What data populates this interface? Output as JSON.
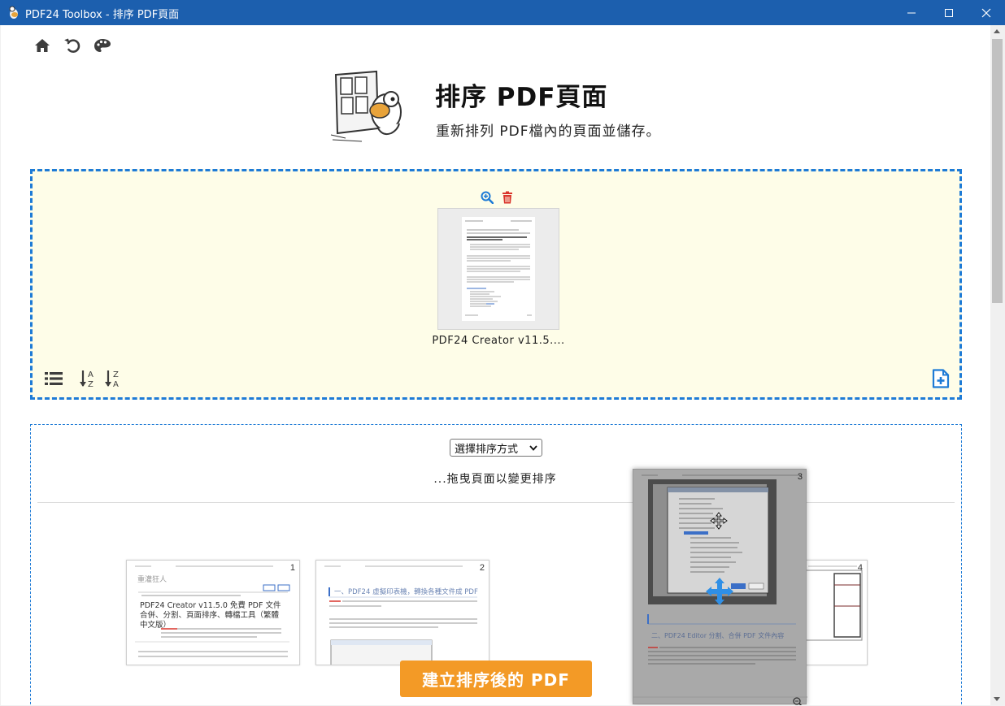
{
  "window": {
    "title": "PDF24 Toolbox - 排序 PDF頁面"
  },
  "header": {
    "title": "排序 PDF頁面",
    "subtitle": "重新排列 PDF檔內的頁面並儲存。"
  },
  "toolbar_icons": [
    "home-icon",
    "undo-icon",
    "palette-icon"
  ],
  "upload": {
    "file_name": "PDF24 Creator v11.5....",
    "tools": [
      "zoom-in-icon",
      "trash-icon"
    ],
    "bottom_icons": [
      "list-view-icon",
      "sort-az-icon",
      "sort-za-icon",
      "add-file-icon"
    ]
  },
  "sort": {
    "select_value": "選擇排序方式",
    "hint": "...拖曳頁面以變更排序",
    "pages": [
      {
        "num": "1",
        "heading": "PDF24 Creator v11.5.0 免費 PDF 文件合併、分割、頁面排序、轉檔工具（繁體中文版）",
        "blog": "重灌狂人"
      },
      {
        "num": "2",
        "heading": "一、PDF24 虛擬印表機，轉換各種文件成 PDF"
      },
      {
        "num": "3",
        "heading": "二、PDF24 Editor 分割、合併 PDF 文件內容"
      },
      {
        "num": "4"
      }
    ]
  },
  "actions": {
    "create_label": "建立排序後的 PDF"
  },
  "colors": {
    "titlebar": "#1c5fae",
    "accent_blue": "#1e7bd6",
    "dropzone_bg": "#fefde8",
    "button_orange": "#f39a26",
    "trash_red": "#d9342b"
  }
}
